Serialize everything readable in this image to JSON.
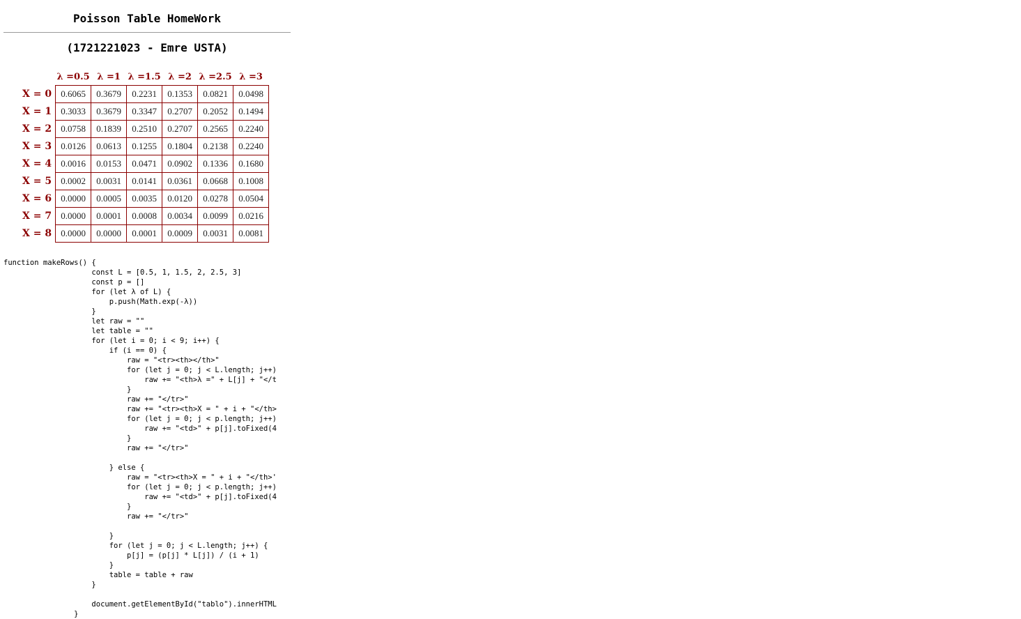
{
  "title": "Poisson Table HomeWork",
  "subtitle": "(1721221023 - Emre USTA)",
  "table": {
    "headers": [
      "λ =0.5",
      "λ =1",
      "λ =1.5",
      "λ =2",
      "λ =2.5",
      "λ =3"
    ],
    "rows": [
      {
        "label": "X = 0",
        "cells": [
          "0.6065",
          "0.3679",
          "0.2231",
          "0.1353",
          "0.0821",
          "0.0498"
        ]
      },
      {
        "label": "X = 1",
        "cells": [
          "0.3033",
          "0.3679",
          "0.3347",
          "0.2707",
          "0.2052",
          "0.1494"
        ]
      },
      {
        "label": "X = 2",
        "cells": [
          "0.0758",
          "0.1839",
          "0.2510",
          "0.2707",
          "0.2565",
          "0.2240"
        ]
      },
      {
        "label": "X = 3",
        "cells": [
          "0.0126",
          "0.0613",
          "0.1255",
          "0.1804",
          "0.2138",
          "0.2240"
        ]
      },
      {
        "label": "X = 4",
        "cells": [
          "0.0016",
          "0.0153",
          "0.0471",
          "0.0902",
          "0.1336",
          "0.1680"
        ]
      },
      {
        "label": "X = 5",
        "cells": [
          "0.0002",
          "0.0031",
          "0.0141",
          "0.0361",
          "0.0668",
          "0.1008"
        ]
      },
      {
        "label": "X = 6",
        "cells": [
          "0.0000",
          "0.0005",
          "0.0035",
          "0.0120",
          "0.0278",
          "0.0504"
        ]
      },
      {
        "label": "X = 7",
        "cells": [
          "0.0000",
          "0.0001",
          "0.0008",
          "0.0034",
          "0.0099",
          "0.0216"
        ]
      },
      {
        "label": "X = 8",
        "cells": [
          "0.0000",
          "0.0000",
          "0.0001",
          "0.0009",
          "0.0031",
          "0.0081"
        ]
      }
    ]
  },
  "code": "function makeRows() {\n                    const L = [0.5, 1, 1.5, 2, 2.5, 3]\n                    const p = []\n                    for (let λ of L) {\n                        p.push(Math.exp(-λ))\n                    }\n                    let raw = \"\"\n                    let table = \"\"\n                    for (let i = 0; i < 9; i++) {\n                        if (i == 0) {\n                            raw = \"<tr><th></th>\"\n                            for (let j = 0; j < L.length; j++)\n                                raw += \"<th>λ =\" + L[j] + \"</t\n                            }\n                            raw += \"</tr>\"\n                            raw += \"<tr><th>X = \" + i + \"</th>\n                            for (let j = 0; j < p.length; j++)\n                                raw += \"<td>\" + p[j].toFixed(4\n                            }\n                            raw += \"</tr>\"\n\n                        } else {\n                            raw = \"<tr><th>X = \" + i + \"</th>'\n                            for (let j = 0; j < p.length; j++)\n                                raw += \"<td>\" + p[j].toFixed(4\n                            }\n                            raw += \"</tr>\"\n\n                        }\n                        for (let j = 0; j < L.length; j++) {\n                            p[j] = (p[j] * L[j]) / (i + 1)\n                        }\n                        table = table + raw\n                    }\n\n                    document.getElementById(\"tablo\").innerHTML\n                }"
}
